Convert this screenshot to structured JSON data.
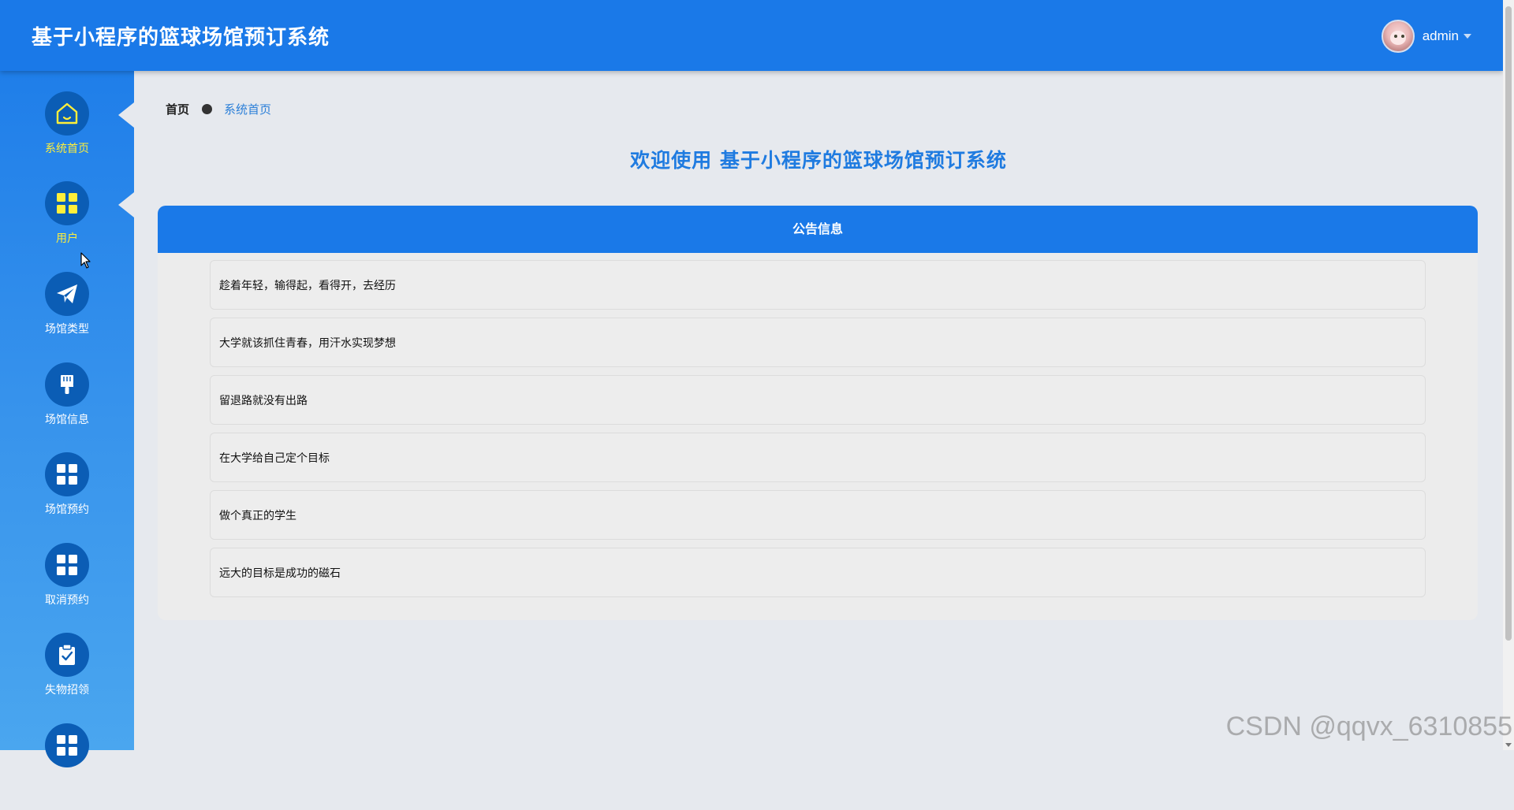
{
  "header": {
    "title": "基于小程序的篮球场馆预订系统",
    "user_name": "admin"
  },
  "sidebar": {
    "items": [
      {
        "label": "系统首页",
        "icon": "home-icon"
      },
      {
        "label": "用户",
        "icon": "grid-icon"
      },
      {
        "label": "场馆类型",
        "icon": "paper-plane-icon"
      },
      {
        "label": "场馆信息",
        "icon": "brush-icon"
      },
      {
        "label": "场馆预约",
        "icon": "grid-icon"
      },
      {
        "label": "取消预约",
        "icon": "grid-icon"
      },
      {
        "label": "失物招领",
        "icon": "clipboard-check-icon"
      },
      {
        "label": "",
        "icon": "grid-icon"
      }
    ]
  },
  "breadcrumb": {
    "home": "首页",
    "current": "系统首页"
  },
  "welcome": "欢迎使用 基于小程序的篮球场馆预订系统",
  "notice": {
    "title": "公告信息",
    "items": [
      "趁着年轻，输得起，看得开，去经历",
      "大学就该抓住青春，用汗水实现梦想",
      "留退路就没有出路",
      "在大学给自己定个目标",
      "做个真正的学生",
      "远大的目标是成功的磁石"
    ]
  },
  "colors": {
    "primary": "#1a79e8",
    "active_label": "#ffef3a",
    "icon_yellow": "#ffef3a"
  },
  "watermark": "CSDN @qqvx_6310855"
}
